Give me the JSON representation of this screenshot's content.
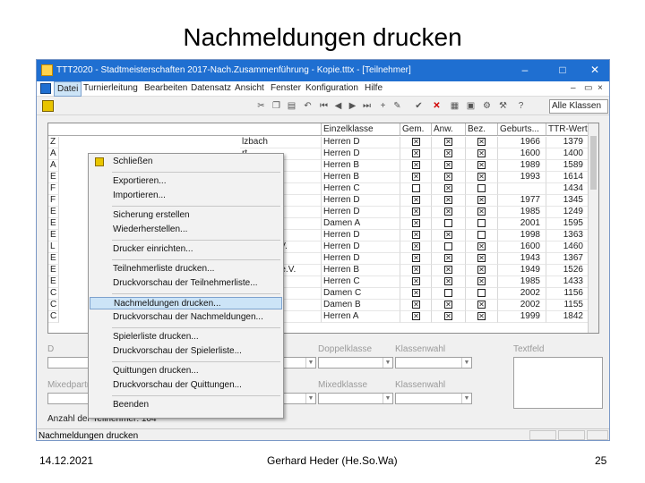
{
  "slide": {
    "title": "Nachmeldungen drucken",
    "date": "14.12.2021",
    "author": "Gerhard Heder (He.So.Wa)",
    "page": "25"
  },
  "window": {
    "title": "TTT2020 - Stadtmeisterschaften 2017-Nach.Zusammenführung - Kopie.tttx - [Teilnehmer]",
    "controls": [
      "–",
      "□",
      "✕"
    ]
  },
  "menubar": {
    "items": [
      "Datei",
      "Turnierleitung",
      "Bearbeiten",
      "Datensatz",
      "Ansicht",
      "Fenster",
      "Konfiguration",
      "Hilfe"
    ],
    "active_index": 0,
    "mdi_controls": [
      "–",
      "▭",
      "×"
    ]
  },
  "toolbar": {
    "combo_value": "Alle Klassen"
  },
  "file_menu": {
    "items": [
      {
        "label": "Schließen",
        "group_end": true,
        "icon": "exit-icon"
      },
      {
        "label": "Exportieren...",
        "group_end": false
      },
      {
        "label": "Importieren...",
        "group_end": true
      },
      {
        "label": "Sicherung erstellen",
        "group_end": false
      },
      {
        "label": "Wiederherstellen...",
        "group_end": true
      },
      {
        "label": "Drucker einrichten...",
        "group_end": true
      },
      {
        "label": "Teilnehmerliste drucken...",
        "group_end": false
      },
      {
        "label": "Druckvorschau der Teilnehmerliste...",
        "group_end": true
      },
      {
        "label": "Nachmeldungen drucken...",
        "group_end": false,
        "selected": true
      },
      {
        "label": "Druckvorschau der Nachmeldungen...",
        "group_end": true
      },
      {
        "label": "Spielerliste drucken...",
        "group_end": false
      },
      {
        "label": "Druckvorschau der Spielerliste...",
        "group_end": true
      },
      {
        "label": "Quittungen drucken...",
        "group_end": false
      },
      {
        "label": "Druckvorschau der Quittungen...",
        "group_end": true
      },
      {
        "label": "Beenden",
        "group_end": false
      }
    ]
  },
  "table": {
    "columns": [
      "Einzelklasse",
      "Gem.",
      "Anw.",
      "Bez.",
      "Geburts...",
      "TTR-Wert"
    ],
    "rows": [
      {
        "marker": "Z",
        "club": "lzbach",
        "klasse": "Herren D",
        "gem": true,
        "anw": true,
        "bez": true,
        "geb": "1966",
        "ttr": "1379"
      },
      {
        "marker": "A",
        "club": "rt",
        "klasse": "Herren D",
        "gem": true,
        "anw": true,
        "bez": true,
        "geb": "1600",
        "ttr": "1400"
      },
      {
        "marker": "A",
        "club": "",
        "klasse": "Herren B",
        "gem": true,
        "anw": true,
        "bez": true,
        "geb": "1989",
        "ttr": "1589"
      },
      {
        "marker": "E",
        "club": "eid",
        "klasse": "Herren B",
        "gem": true,
        "anw": true,
        "bez": true,
        "geb": "1993",
        "ttr": "1614"
      },
      {
        "marker": "F",
        "club": "lhelmsdorf",
        "klasse": "Herren C",
        "gem": false,
        "anw": true,
        "bez": false,
        "geb": "",
        "ttr": "1434"
      },
      {
        "marker": "F",
        "club": "",
        "klasse": "Herren D",
        "gem": true,
        "anw": true,
        "bez": true,
        "geb": "1977",
        "ttr": "1345"
      },
      {
        "marker": "E",
        "club": "dt",
        "klasse": "Herren D",
        "gem": true,
        "anw": true,
        "bez": true,
        "geb": "1985",
        "ttr": "1249"
      },
      {
        "marker": "E",
        "club": "lzbach",
        "klasse": "Damen A",
        "gem": true,
        "anw": false,
        "bez": false,
        "geb": "2001",
        "ttr": "1595"
      },
      {
        "marker": "E",
        "club": "ldt",
        "klasse": "Herren D",
        "gem": true,
        "anw": true,
        "bez": false,
        "geb": "1998",
        "ttr": "1363"
      },
      {
        "marker": "L",
        "club": "enberg e.V.",
        "klasse": "Herren D",
        "gem": true,
        "anw": false,
        "bez": true,
        "geb": "1600",
        "ttr": "1460"
      },
      {
        "marker": "E",
        "club": "chen",
        "klasse": "Herren D",
        "gem": true,
        "anw": true,
        "bez": true,
        "geb": "1943",
        "ttr": "1367"
      },
      {
        "marker": "E",
        "club": "hor Furth e.V.",
        "klasse": "Herren B",
        "gem": true,
        "anw": true,
        "bez": true,
        "geb": "1949",
        "ttr": "1526"
      },
      {
        "marker": "E",
        "club": "erm",
        "klasse": "Herren C",
        "gem": true,
        "anw": true,
        "bez": true,
        "geb": "1985",
        "ttr": "1433"
      },
      {
        "marker": "C",
        "club": "sseroth",
        "klasse": "Damen C",
        "gem": true,
        "anw": false,
        "bez": false,
        "geb": "2002",
        "ttr": "1156"
      },
      {
        "marker": "C",
        "club": "sseroth",
        "klasse": "Damen B",
        "gem": true,
        "anw": true,
        "bez": true,
        "geb": "2002",
        "ttr": "1155"
      },
      {
        "marker": "C",
        "club": "uter",
        "klasse": "Herren A",
        "gem": true,
        "anw": true,
        "bez": true,
        "geb": "1999",
        "ttr": "1842"
      }
    ]
  },
  "form": {
    "label_d": "D",
    "doppelklasse_label": "Doppelklasse",
    "klassenwahl_label": "Klassenwahl",
    "textfeld_label": "Textfeld",
    "mixed_partner_label": "Mixedpartner (Nachname, Vorname, Verein)",
    "mixed_klasse_label": "Mixedklasse",
    "klassenwahl2_label": "Klassenwahl",
    "count_text": "Anzahl der Teilnehmer: 104"
  },
  "statusbar": {
    "text": "Nachmeldungen drucken"
  }
}
